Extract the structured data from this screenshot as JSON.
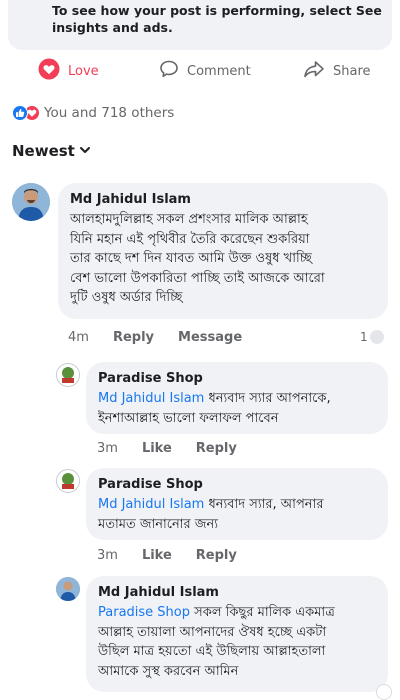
{
  "post": {
    "insights_text": "To see how your post is performing, select See insights and ads."
  },
  "actions": {
    "love": "Love",
    "comment": "Comment",
    "share": "Share"
  },
  "reactions": {
    "summary": "You and 718 others"
  },
  "sort": {
    "label": "Newest"
  },
  "comments": [
    {
      "author": "Md Jahidul Islam",
      "lines": [
        "আলহামদুলিল্লাহ সকল প্রশংসার মালিক আল্লাহ",
        "যিনি মহান এই পৃথিবীর তৈরি করেছেন শুকরিয়া",
        "তার কাছে দশ দিন যাবত আমি উক্ত ওষুধ খাচ্ছি",
        "বেশ ভালো উপকারিতা পাচ্ছি তাই আজকে আরো",
        "দুটি ওষুধ অর্ডার দিচ্ছি"
      ],
      "time": "4m",
      "reply": "Reply",
      "message": "Message",
      "reaction_count": "1"
    },
    {
      "author": "Paradise Shop",
      "mention": "Md Jahidul Islam",
      "line1_rest": " ধন্যবাদ স্যার আপনাকে,",
      "line2": "ইনশাআল্লাহ  ভালো ফলাফল পাবেন",
      "time": "3m",
      "like": "Like",
      "reply": "Reply"
    },
    {
      "author": "Paradise Shop",
      "mention": "Md Jahidul Islam",
      "line1_rest": " ধন্যবাদ স্যার, আপনার",
      "line2": "মতামত জানানোর জন্য",
      "time": "3m",
      "like": "Like",
      "reply": "Reply"
    },
    {
      "author": "Md Jahidul Islam",
      "mention": "Paradise Shop",
      "line1_rest": " সকল কিছুর মালিক একমাত্র",
      "line2": "আল্লাহ তায়ালা আপনাদের ঔষধ হচ্ছে একটা",
      "line3": "উছিল মাত্র হয়তো এই উছিলায় আল্লাহতালা",
      "line4": "আমাকে সুস্থ করবেন আমিন"
    }
  ],
  "colors": {
    "accent": "#1877f2",
    "love": "#f33e58",
    "bubble": "#f0f2f5",
    "meta": "#65676b"
  }
}
